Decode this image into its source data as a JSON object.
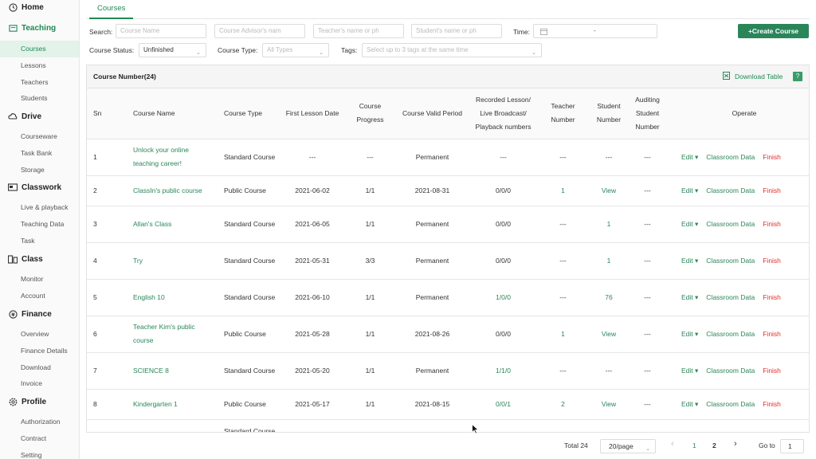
{
  "sidebar": {
    "sections": [
      {
        "title": "Home",
        "icon": "home-icon",
        "items": []
      },
      {
        "title": "Teaching",
        "icon": "teaching-icon",
        "items": [
          "Courses",
          "Lessons",
          "Teachers",
          "Students"
        ]
      },
      {
        "title": "Drive",
        "icon": "cloud-icon",
        "items": [
          "Courseware",
          "Task Bank",
          "Storage"
        ]
      },
      {
        "title": "Classwork",
        "icon": "classwork-icon",
        "items": [
          "Live & playback",
          "Teaching Data",
          "Task"
        ]
      },
      {
        "title": "Class",
        "icon": "class-icon",
        "items": [
          "Monitor",
          "Account"
        ]
      },
      {
        "title": "Finance",
        "icon": "finance-icon",
        "items": [
          "Overview",
          "Finance Details",
          "Download",
          "Invoice"
        ]
      },
      {
        "title": "Profile",
        "icon": "profile-gear-icon",
        "items": [
          "Authorization",
          "Contract",
          "Setting"
        ]
      }
    ],
    "active_section": "Teaching",
    "active_item": "Courses"
  },
  "tabs": {
    "courses": "Courses"
  },
  "filters": {
    "search_label": "Search:",
    "course_name_ph": "Course Name",
    "advisor_ph": "Course Advisor's nam",
    "teacher_ph": "Teacher's name or ph",
    "student_ph": "Student's name or ph",
    "time_label": "Time:",
    "time_sep": "-",
    "status_label": "Course Status:",
    "status_value": "Unfinished",
    "type_label": "Course Type:",
    "type_ph": "All Types",
    "tags_label": "Tags:",
    "tags_ph": "Select up to 3 tags at the same time",
    "create_btn": "Create Course"
  },
  "table": {
    "count_title": "Course Number(24)",
    "download": "Download Table",
    "help": "?",
    "columns": [
      "Sn",
      "Course Name",
      "Course Type",
      "First Lesson Date",
      "Course Progress",
      "Course Valid Period",
      "Recorded Lesson/ Live Broadcast/ Playback numbers",
      "Teacher Number",
      "Student Number",
      "Auditing Student Number",
      "Operate"
    ],
    "rows": [
      {
        "sn": "1",
        "name": "Unlock your online teaching career!",
        "type": "Standard Course",
        "first": "---",
        "progress": "---",
        "period": "Permanent",
        "recorded": "---",
        "teacher": "---",
        "student": "---",
        "auditing": "---"
      },
      {
        "sn": "2",
        "name": "ClassIn's public course",
        "type": "Public Course",
        "first": "2021-06-02",
        "progress": "1/1",
        "period": "2021-08-31",
        "recorded": "0/0/0",
        "teacher": "1",
        "student": "View",
        "auditing": "---"
      },
      {
        "sn": "3",
        "name": "Allan's Class",
        "type": "Standard Course",
        "first": "2021-06-05",
        "progress": "1/1",
        "period": "Permanent",
        "recorded": "0/0/0",
        "teacher": "---",
        "student": "1",
        "auditing": "---"
      },
      {
        "sn": "4",
        "name": "Try",
        "type": "Standard Course",
        "first": "2021-05-31",
        "progress": "3/3",
        "period": "Permanent",
        "recorded": "0/0/0",
        "teacher": "---",
        "student": "1",
        "auditing": "---"
      },
      {
        "sn": "5",
        "name": "English 10",
        "type": "Standard Course",
        "first": "2021-06-10",
        "progress": "1/1",
        "period": "Permanent",
        "recorded": "1/0/0",
        "teacher": "---",
        "student": "76",
        "auditing": "---"
      },
      {
        "sn": "6",
        "name": "Teacher Kim's public course",
        "type": "Public Course",
        "first": "2021-05-28",
        "progress": "1/1",
        "period": "2021-08-26",
        "recorded": "0/0/0",
        "teacher": "1",
        "student": "View",
        "auditing": "---"
      },
      {
        "sn": "7",
        "name": "SCIENCE 8",
        "type": "Standard Course",
        "first": "2021-05-20",
        "progress": "1/1",
        "period": "Permanent",
        "recorded": "1/1/0",
        "teacher": "---",
        "student": "---",
        "auditing": "---"
      },
      {
        "sn": "8",
        "name": "Kindergarten 1",
        "type": "Public Course",
        "first": "2021-05-17",
        "progress": "1/1",
        "period": "2021-08-15",
        "recorded": "0/0/1",
        "teacher": "2",
        "student": "View",
        "auditing": "---"
      },
      {
        "sn": "",
        "name": "",
        "type": "Standard Course",
        "first": "",
        "progress": "",
        "period": "",
        "recorded": "",
        "teacher": "",
        "student": "",
        "auditing": ""
      }
    ],
    "actions": {
      "edit": "Edit",
      "classroom": "Classroom Data",
      "finish": "Finish"
    }
  },
  "pagination": {
    "total": "Total 24",
    "page_size": "20/page",
    "prev": "‹",
    "pages": [
      "1",
      "2"
    ],
    "next": "›",
    "goto_label": "Go to",
    "goto_value": "1"
  },
  "colors": {
    "accent": "#2a8659",
    "danger": "#e0302b"
  }
}
